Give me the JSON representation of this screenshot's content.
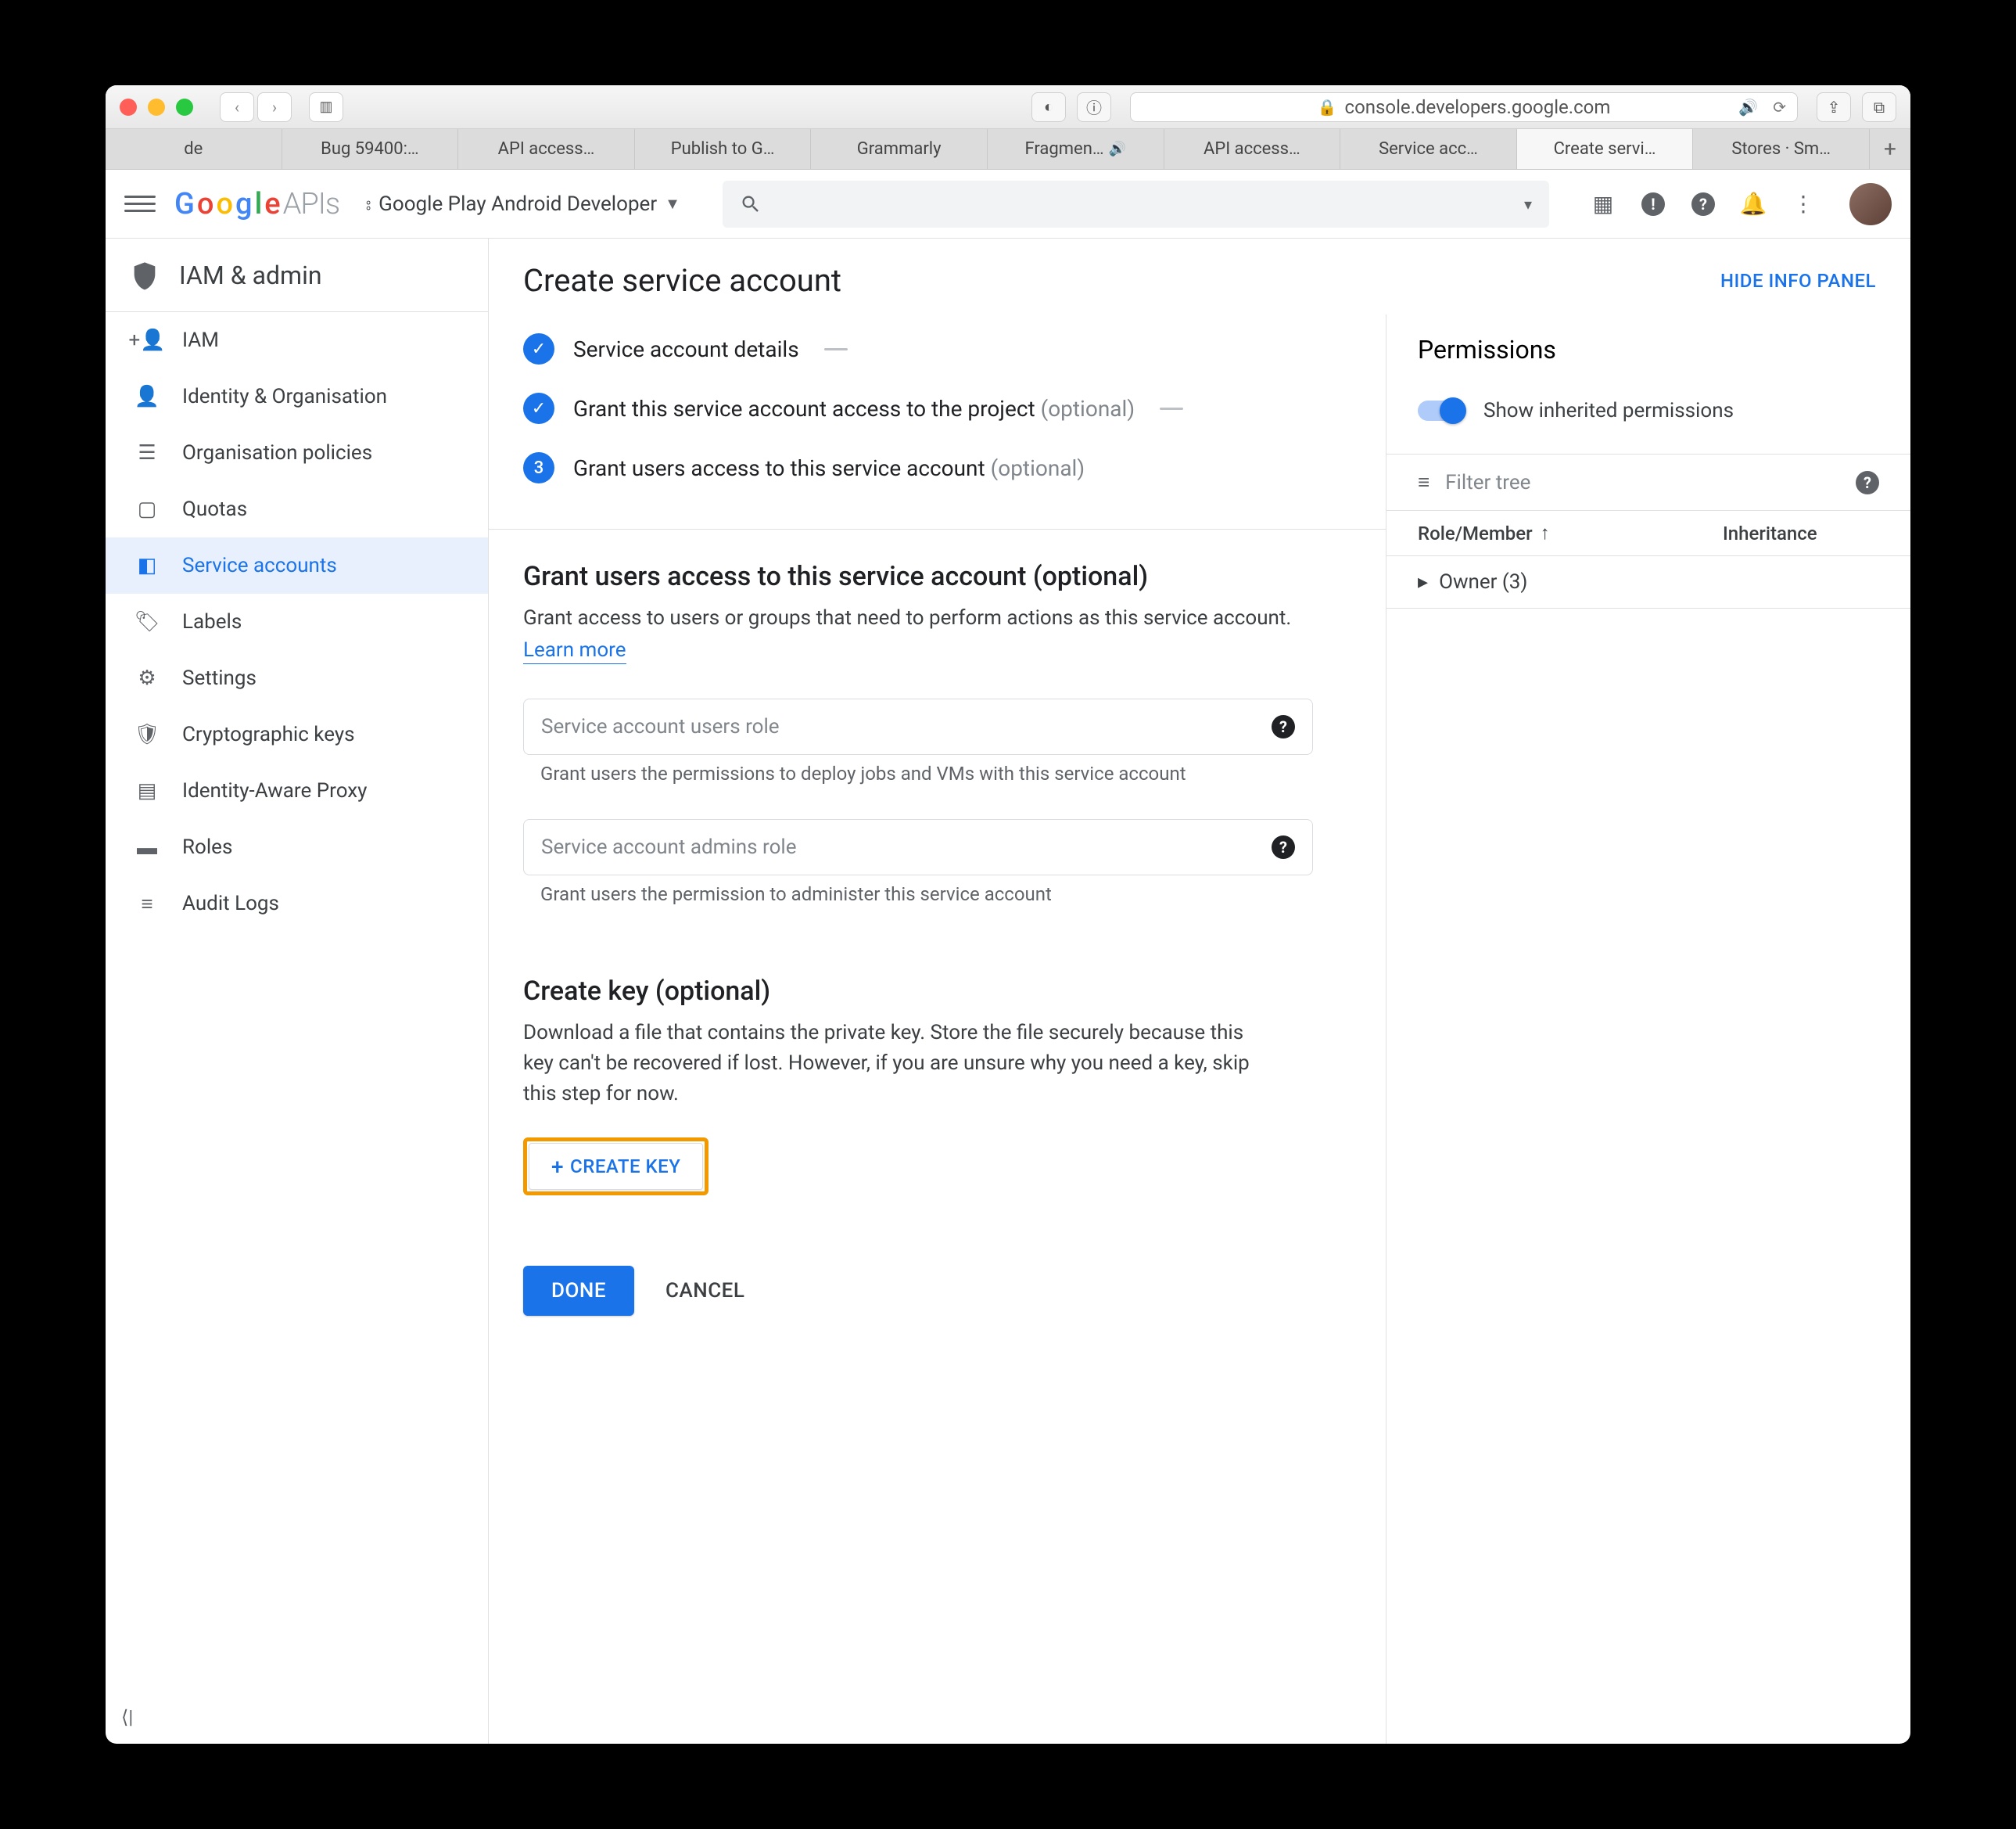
{
  "browser": {
    "url": "console.developers.google.com",
    "tabs": [
      "de",
      "Bug 59400:…",
      "API access…",
      "Publish to G…",
      "Grammarly",
      "Fragmen…",
      "API access…",
      "Service acc…",
      "Create servi…",
      "Stores · Sm…"
    ],
    "active_tab_index": 8
  },
  "header": {
    "logo_apis": "APIs",
    "project": "Google Play Android Developer"
  },
  "sidebar": {
    "title": "IAM & admin",
    "items": [
      {
        "label": "IAM",
        "icon": "person-add-icon"
      },
      {
        "label": "Identity & Organisation",
        "icon": "person-circle-icon"
      },
      {
        "label": "Organisation policies",
        "icon": "list-icon"
      },
      {
        "label": "Quotas",
        "icon": "meter-icon"
      },
      {
        "label": "Service accounts",
        "icon": "key-badge-icon"
      },
      {
        "label": "Labels",
        "icon": "tag-icon"
      },
      {
        "label": "Settings",
        "icon": "gear-icon"
      },
      {
        "label": "Cryptographic keys",
        "icon": "shield-key-icon"
      },
      {
        "label": "Identity-Aware Proxy",
        "icon": "proxy-icon"
      },
      {
        "label": "Roles",
        "icon": "hat-icon"
      },
      {
        "label": "Audit Logs",
        "icon": "lines-icon"
      }
    ],
    "selected_index": 4
  },
  "main": {
    "title": "Create service account",
    "hide_panel": "HIDE INFO PANEL",
    "steps": {
      "s1": "Service account details",
      "s2": "Grant this service account access to the project",
      "s2_opt": "(optional)",
      "s3": "Grant users access to this service account",
      "s3_opt": "(optional)",
      "s3_num": "3"
    },
    "section1": {
      "heading": "Grant users access to this service account (optional)",
      "desc": "Grant access to users or groups that need to perform actions as this service account.",
      "learn_more": "Learn more",
      "field1_ph": "Service account users role",
      "field1_help": "Grant users the permissions to deploy jobs and VMs with this service account",
      "field2_ph": "Service account admins role",
      "field2_help": "Grant users the permission to administer this service account"
    },
    "section2": {
      "heading": "Create key (optional)",
      "desc": "Download a file that contains the private key. Store the file securely because this key can't be recovered if lost. However, if you are unsure why you need a key, skip this step for now.",
      "create_key": "CREATE KEY"
    },
    "actions": {
      "done": "DONE",
      "cancel": "CANCEL"
    }
  },
  "permissions": {
    "title": "Permissions",
    "toggle_label": "Show inherited permissions",
    "filter_ph": "Filter tree",
    "col1": "Role/Member",
    "col2": "Inheritance",
    "owner_row": "Owner (3)"
  }
}
